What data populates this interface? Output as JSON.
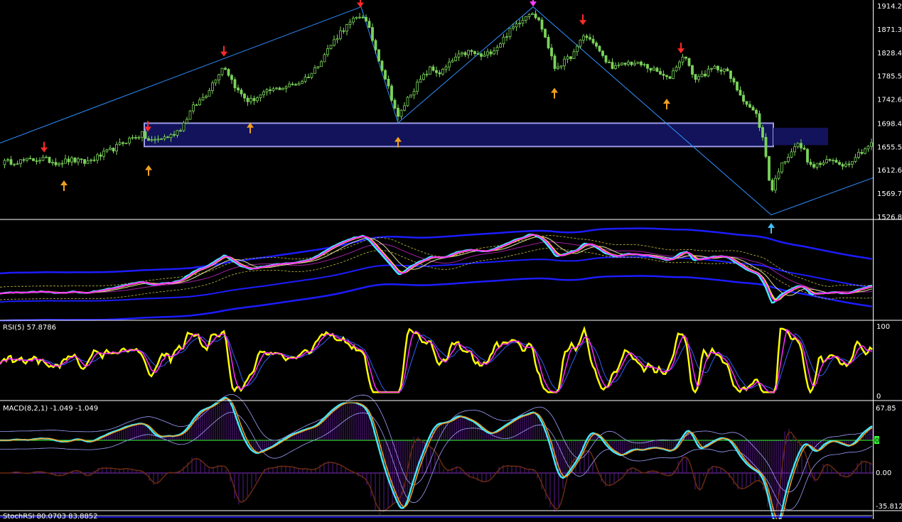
{
  "colors": {
    "background": "#000000",
    "separator": "#ffffff",
    "bull_candle": "#7bd35a",
    "trend_line": "#2f8fff",
    "zone_fill": "#12135a",
    "zone_border": "#9a9ae6",
    "arrow_down": "#ff2a2a",
    "arrow_up": "#f0a020",
    "arrow_top": "#ff40ff",
    "arrow_bottom": "#40c0ff",
    "yellow": "#ffff00",
    "magenta": "#ff2aff",
    "cyan": "#40e8ff",
    "blue": "#1c1cff",
    "white": "#ffffff",
    "green": "#33ff33",
    "histogram": "#5a1a8a",
    "brown": "#6a2a10"
  },
  "chart_data": [
    {
      "type": "candlestick",
      "panel": "price",
      "ylim": [
        1526.8,
        1914.2
      ],
      "yticks": [
        "1914.20",
        "1871.30",
        "1828.40",
        "1785.50",
        "1742.60",
        "1698.40",
        "1655.50",
        "1612.60",
        "1569.70",
        "1526.80"
      ],
      "close_path": [
        [
          0,
          1626
        ],
        [
          20,
          1628
        ],
        [
          40,
          1630
        ],
        [
          60,
          1633
        ],
        [
          80,
          1626
        ],
        [
          100,
          1631
        ],
        [
          120,
          1626
        ],
        [
          140,
          1638
        ],
        [
          160,
          1652
        ],
        [
          180,
          1668
        ],
        [
          200,
          1678
        ],
        [
          210,
          1665
        ],
        [
          225,
          1670
        ],
        [
          240,
          1675
        ],
        [
          255,
          1690
        ],
        [
          270,
          1725
        ],
        [
          290,
          1752
        ],
        [
          305,
          1785
        ],
        [
          315,
          1805
        ],
        [
          325,
          1780
        ],
        [
          335,
          1757
        ],
        [
          350,
          1738
        ],
        [
          365,
          1748
        ],
        [
          380,
          1758
        ],
        [
          400,
          1765
        ],
        [
          420,
          1772
        ],
        [
          440,
          1792
        ],
        [
          460,
          1832
        ],
        [
          480,
          1868
        ],
        [
          500,
          1890
        ],
        [
          510,
          1898
        ],
        [
          520,
          1868
        ],
        [
          530,
          1828
        ],
        [
          545,
          1770
        ],
        [
          560,
          1708
        ],
        [
          575,
          1748
        ],
        [
          590,
          1775
        ],
        [
          605,
          1798
        ],
        [
          620,
          1790
        ],
        [
          640,
          1818
        ],
        [
          660,
          1830
        ],
        [
          680,
          1820
        ],
        [
          700,
          1840
        ],
        [
          715,
          1865
        ],
        [
          730,
          1885
        ],
        [
          748,
          1905
        ],
        [
          760,
          1882
        ],
        [
          770,
          1845
        ],
        [
          780,
          1800
        ],
        [
          795,
          1812
        ],
        [
          810,
          1830
        ],
        [
          820,
          1860
        ],
        [
          835,
          1848
        ],
        [
          850,
          1815
        ],
        [
          865,
          1800
        ],
        [
          885,
          1810
        ],
        [
          905,
          1805
        ],
        [
          925,
          1792
        ],
        [
          940,
          1778
        ],
        [
          955,
          1812
        ],
        [
          965,
          1822
        ],
        [
          975,
          1780
        ],
        [
          990,
          1788
        ],
        [
          1005,
          1800
        ],
        [
          1020,
          1798
        ],
        [
          1035,
          1765
        ],
        [
          1050,
          1735
        ],
        [
          1065,
          1712
        ],
        [
          1075,
          1660
        ],
        [
          1085,
          1570
        ],
        [
          1095,
          1612
        ],
        [
          1110,
          1642
        ],
        [
          1120,
          1660
        ],
        [
          1130,
          1652
        ],
        [
          1140,
          1618
        ],
        [
          1155,
          1624
        ],
        [
          1170,
          1630
        ],
        [
          1190,
          1622
        ],
        [
          1205,
          1640
        ],
        [
          1225,
          1660
        ]
      ],
      "zone": {
        "y_top": 1698.4,
        "y_bottom": 1655.5,
        "x_start": 203,
        "x_end": 1088
      },
      "zone_ext": {
        "y_top": 1690,
        "y_bottom": 1658,
        "x_start": 1088,
        "x_end": 1165
      },
      "trend_lines": [
        [
          [
            0,
            1662
          ],
          [
            508,
            1912
          ]
        ],
        [
          [
            508,
            1912
          ],
          [
            560,
            1699
          ],
          [
            750,
            1912
          ],
          [
            1085,
            1530
          ],
          [
            1228,
            1598
          ]
        ]
      ],
      "arrows_down": [
        [
          62,
          1646
        ],
        [
          208,
          1684
        ],
        [
          315,
          1822
        ],
        [
          507,
          1912
        ],
        [
          820,
          1880
        ],
        [
          958,
          1828
        ]
      ],
      "arrows_up": [
        [
          90,
          1610
        ],
        [
          209,
          1638
        ],
        [
          352,
          1716
        ],
        [
          560,
          1690
        ],
        [
          780,
          1780
        ],
        [
          938,
          1760
        ]
      ],
      "arrow_top": [
        750,
        1914
      ],
      "arrow_bottom": [
        1085,
        1528
      ]
    },
    {
      "type": "line",
      "panel": "moving-averages",
      "series": []
    },
    {
      "type": "line",
      "panel": "rsi",
      "title": "RSI(5) 57.8786",
      "ylim": [
        0,
        100
      ],
      "yticks": [
        "100",
        "0"
      ],
      "series": []
    },
    {
      "type": "bar",
      "panel": "macd",
      "title": "MACD(8,2,1) -1.049 -1.049",
      "ylim": [
        -35.812,
        67.85
      ],
      "yticks": [
        "67.85",
        "0.00",
        "-35.812"
      ],
      "signal_marker": "0",
      "series": []
    },
    {
      "type": "line",
      "panel": "stoch",
      "title": "StochRSI 80.0703 83.8852",
      "series": []
    }
  ]
}
